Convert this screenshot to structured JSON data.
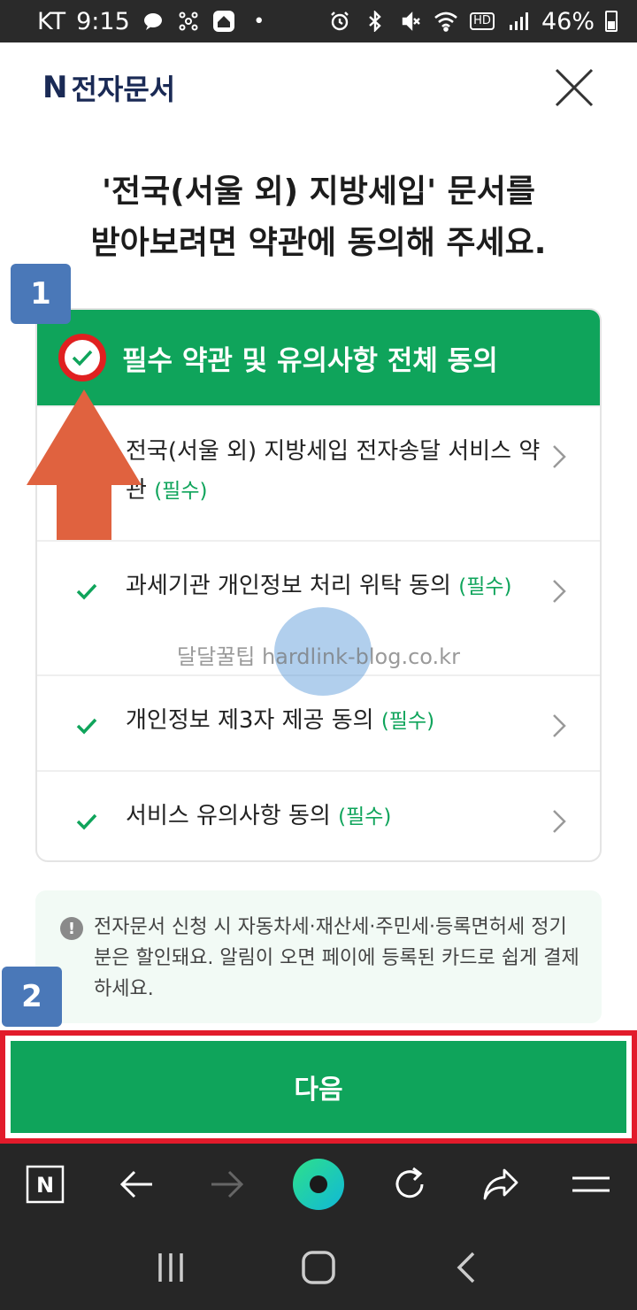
{
  "status_bar": {
    "carrier": "KT",
    "time": "9:15",
    "battery": "46%",
    "hd_label": "HD"
  },
  "header": {
    "logo_letter": "N",
    "logo_text": "전자문서"
  },
  "heading": {
    "line1": "'전국(서울 외) 지방세입' 문서를",
    "line2": "받아보려면 약관에 동의해 주세요."
  },
  "agreement": {
    "all_label": "필수 약관 및 유의사항 전체 동의",
    "items": [
      {
        "label": "전국(서울 외) 지방세입 전자송달 서비스 약관",
        "tag": "(필수)"
      },
      {
        "label": "과세기관 개인정보 처리 위탁 동의",
        "tag": "(필수)"
      },
      {
        "label": "개인정보 제3자 제공 동의",
        "tag": "(필수)"
      },
      {
        "label": "서비스 유의사항 동의",
        "tag": "(필수)"
      }
    ]
  },
  "notice": {
    "icon": "!",
    "text": "전자문서 신청 시 자동차세·재산세·주민세·등록면허세 정기분은 할인돼요. 알림이 오면 페이에 등록된 카드로 쉽게 결제하세요."
  },
  "next_button": {
    "label": "다음"
  },
  "markers": {
    "step1": "1",
    "step2": "2"
  },
  "watermark": {
    "text": "달달꿀팁 hardlink-blog.co.kr"
  },
  "toolbar": {
    "home_letter": "N"
  },
  "colors": {
    "brand_green": "#0fa45b",
    "highlight_red": "#e21b2b",
    "marker_blue": "#4a78b8",
    "arrow_orange": "#e0623f"
  }
}
